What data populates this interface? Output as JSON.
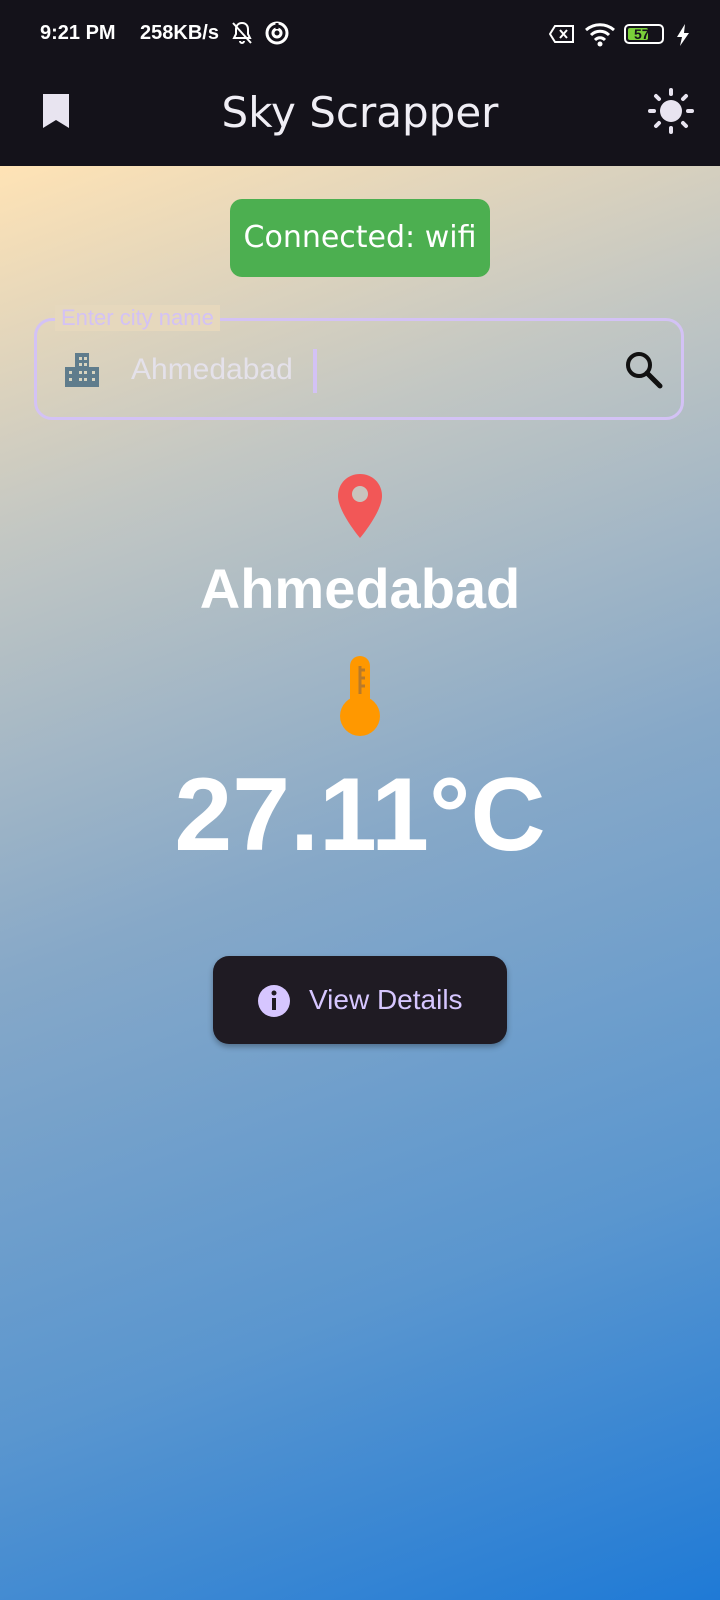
{
  "status_bar": {
    "time": "9:21 PM",
    "net_speed": "258KB/s",
    "battery": "57",
    "icons": [
      "bell-off-icon",
      "data-saver-icon",
      "sim-x-icon",
      "wifi-icon",
      "battery-icon",
      "charging-bolt-icon"
    ]
  },
  "app_bar": {
    "title": "Sky Scrapper",
    "left_icon": "bookmark-icon",
    "right_icon": "brightness-icon"
  },
  "connection": {
    "text": "Connected: wifi",
    "color": "#4caf50"
  },
  "search": {
    "label": "Enter city name",
    "value": "Ahmedabad",
    "prefix_icon": "city-icon",
    "suffix_icon": "search-icon"
  },
  "weather": {
    "city": "Ahmedabad",
    "temperature": "27.11°C",
    "location_icon": "location-pin-icon",
    "temperature_icon": "thermometer-icon"
  },
  "actions": {
    "details_label": "View Details",
    "details_icon": "info-icon"
  },
  "colors": {
    "accent": "#d3c2f5",
    "pin": "#f25757",
    "thermometer": "#ff9800",
    "button_bg": "#1f1b23"
  }
}
